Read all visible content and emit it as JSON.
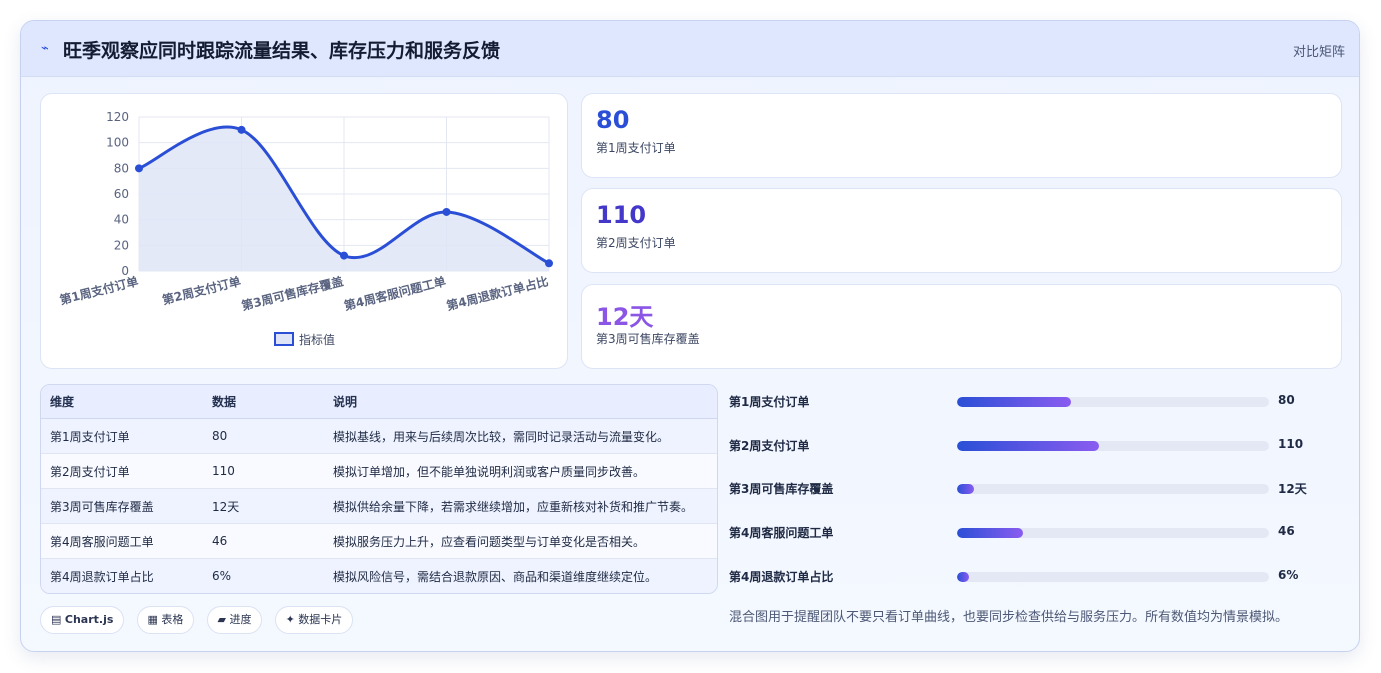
{
  "header": {
    "logo_glyph": "⌁",
    "title": "旺季观察应同时跟踪流量结果、库存压力和服务反馈",
    "link": "对比矩阵"
  },
  "chart_data": {
    "type": "line",
    "categories": [
      "第1周支付订单",
      "第2周支付订单",
      "第3周可售库存覆盖",
      "第4周客服问题工单",
      "第4周退款订单占比"
    ],
    "series": [
      {
        "name": "指标值",
        "values": [
          80,
          110,
          12,
          46,
          6
        ]
      }
    ],
    "ylim": [
      0,
      120
    ],
    "yticks": [
      0,
      20,
      40,
      60,
      80,
      100,
      120
    ],
    "legend": "bottom",
    "grid": true,
    "area_fill": true,
    "colors": {
      "line": "#2a4fd6",
      "fill": "#dfe5f7"
    }
  },
  "kpis": [
    {
      "value": "80",
      "label": "第1周支付订单",
      "color": "#2a4fd6"
    },
    {
      "value": "110",
      "label": "第2周支付订单",
      "color": "#4338ca"
    },
    {
      "value": "12天",
      "label": "第3周可售库存覆盖",
      "color": "#8b55e6"
    }
  ],
  "table": {
    "headers": [
      "维度",
      "数据",
      "说明"
    ],
    "rows": [
      [
        "第1周支付订单",
        "80",
        "模拟基线，用来与后续周次比较，需同时记录活动与流量变化。"
      ],
      [
        "第2周支付订单",
        "110",
        "模拟订单增加，但不能单独说明利润或客户质量同步改善。"
      ],
      [
        "第3周可售库存覆盖",
        "12天",
        "模拟供给余量下降，若需求继续增加，应重新核对补货和推广节奏。"
      ],
      [
        "第4周客服问题工单",
        "46",
        "模拟服务压力上升，应查看问题类型与订单变化是否相关。"
      ],
      [
        "第4周退款订单占比",
        "6%",
        "模拟风险信号，需结合退款原因、商品和渠道维度继续定位。"
      ]
    ]
  },
  "tags": [
    {
      "icon": "▤",
      "label": "Chart.js"
    },
    {
      "icon": "▦",
      "label": "表格"
    },
    {
      "icon": "▰",
      "label": "进度"
    },
    {
      "icon": "✦",
      "label": "数据卡片"
    }
  ],
  "bars": [
    {
      "label": "第1周支付订单",
      "value": "80",
      "fraction": 0.365
    },
    {
      "label": "第2周支付订单",
      "value": "110",
      "fraction": 0.455
    },
    {
      "label": "第3周可售库存覆盖",
      "value": "12天",
      "fraction": 0.055
    },
    {
      "label": "第4周客服问题工单",
      "value": "46",
      "fraction": 0.21
    },
    {
      "label": "第4周退款订单占比",
      "value": "6%",
      "fraction": 0.038
    }
  ],
  "note": "混合图用于提醒团队不要只看订单曲线，也要同步检查供给与服务压力。所有数值均为情景模拟。"
}
